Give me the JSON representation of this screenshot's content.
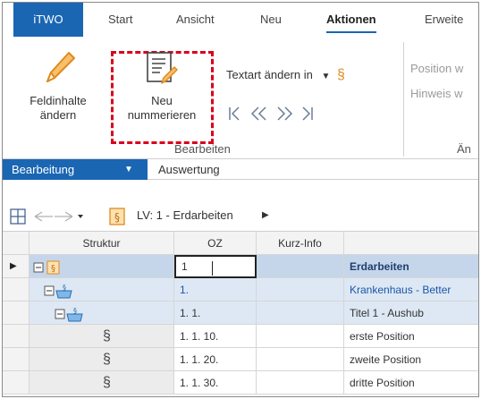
{
  "ribbon_tabs": [
    {
      "label": "iTWO"
    },
    {
      "label": "Start"
    },
    {
      "label": "Ansicht"
    },
    {
      "label": "Neu"
    },
    {
      "label": "Aktionen"
    },
    {
      "label": "Erweite"
    }
  ],
  "ribbon": {
    "feldinhalte_line1": "Feldinhalte",
    "feldinhalte_line2": "ändern",
    "neu_line1": "Neu",
    "neu_line2": "nummerieren",
    "textart_label": "Textart ändern in",
    "group_bearbeiten": "Bearbeiten",
    "group_partial": "Än",
    "position_partial": "Position w",
    "hinweis_partial": "Hinweis w"
  },
  "subtabs": [
    {
      "label": "Bearbeitung"
    },
    {
      "label": "Auswertung"
    }
  ],
  "navbar": {
    "path": "LV: 1 - Erdarbeiten"
  },
  "grid": {
    "headers": [
      "Struktur",
      "OZ",
      "Kurz-Info",
      ""
    ],
    "rows": [
      {
        "oz": "1",
        "text": "Erdarbeiten"
      },
      {
        "oz": "1.",
        "text": "Krankenhaus - Better"
      },
      {
        "oz": "1. 1.",
        "text": "Titel 1 - Aushub"
      },
      {
        "oz": "1. 1. 10.",
        "text": "erste Position"
      },
      {
        "oz": "1. 1. 20.",
        "text": "zweite Position"
      },
      {
        "oz": "1. 1. 30.",
        "text": "dritte Position"
      }
    ]
  },
  "colors": {
    "accent": "#1a66b3",
    "highlight": "#d9001b",
    "selected_row": "#c5d6ea",
    "icon_orange": "#f0a030"
  }
}
